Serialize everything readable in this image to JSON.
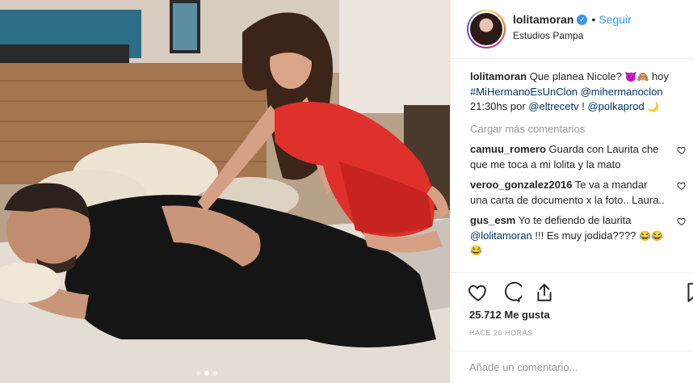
{
  "post": {
    "username": "lolitamoran",
    "verified_mark": "✓",
    "separator": "•",
    "follow_label": "Seguir",
    "location": "Estudios Pampa"
  },
  "caption": {
    "username": "lolitamoran",
    "text_1": "Que planea Nicole? ",
    "emoji_1": "😈🙈",
    "text_2": " hoy ",
    "hashtag": "#MiHermanoEsUnClon",
    "text_3": " ",
    "mention_1": "@mihermanoclon",
    "text_4": " 21:30hs por ",
    "mention_2": "@eltrecetv",
    "text_5": " ! ",
    "mention_3": "@polkaprod",
    "emoji_2": " 🌙"
  },
  "load_more_label": "Cargar más comentarios",
  "comments": [
    {
      "username": "camuu_romero",
      "text": "Guarda con Laurita che que me toca a mi lolita y la mato"
    },
    {
      "username": "veroo_gonzalez2016",
      "text": "Te va a mandar una carta de documento x la foto.. Laura.."
    },
    {
      "username": "gus_esm",
      "text_1": "Yo te defiendo de laurita ",
      "mention": "@lolitamoran",
      "text_2": " !!! Es muy jodida???? ",
      "emoji": "😂😂😂"
    }
  ],
  "likes_text": "25.712 Me gusta",
  "timestamp": "HACE 20 HORAS",
  "add_comment_placeholder": "Añade un comentario...",
  "carousel": {
    "count": 3,
    "active": 2
  },
  "colors": {
    "accent_blue": "#3897f0",
    "link": "#003569",
    "muted": "#999999",
    "border": "#efefef",
    "dress_red": "#e0302b"
  },
  "icons": [
    "heart-icon",
    "comment-icon",
    "share-icon",
    "bookmark-icon",
    "verified-icon"
  ]
}
